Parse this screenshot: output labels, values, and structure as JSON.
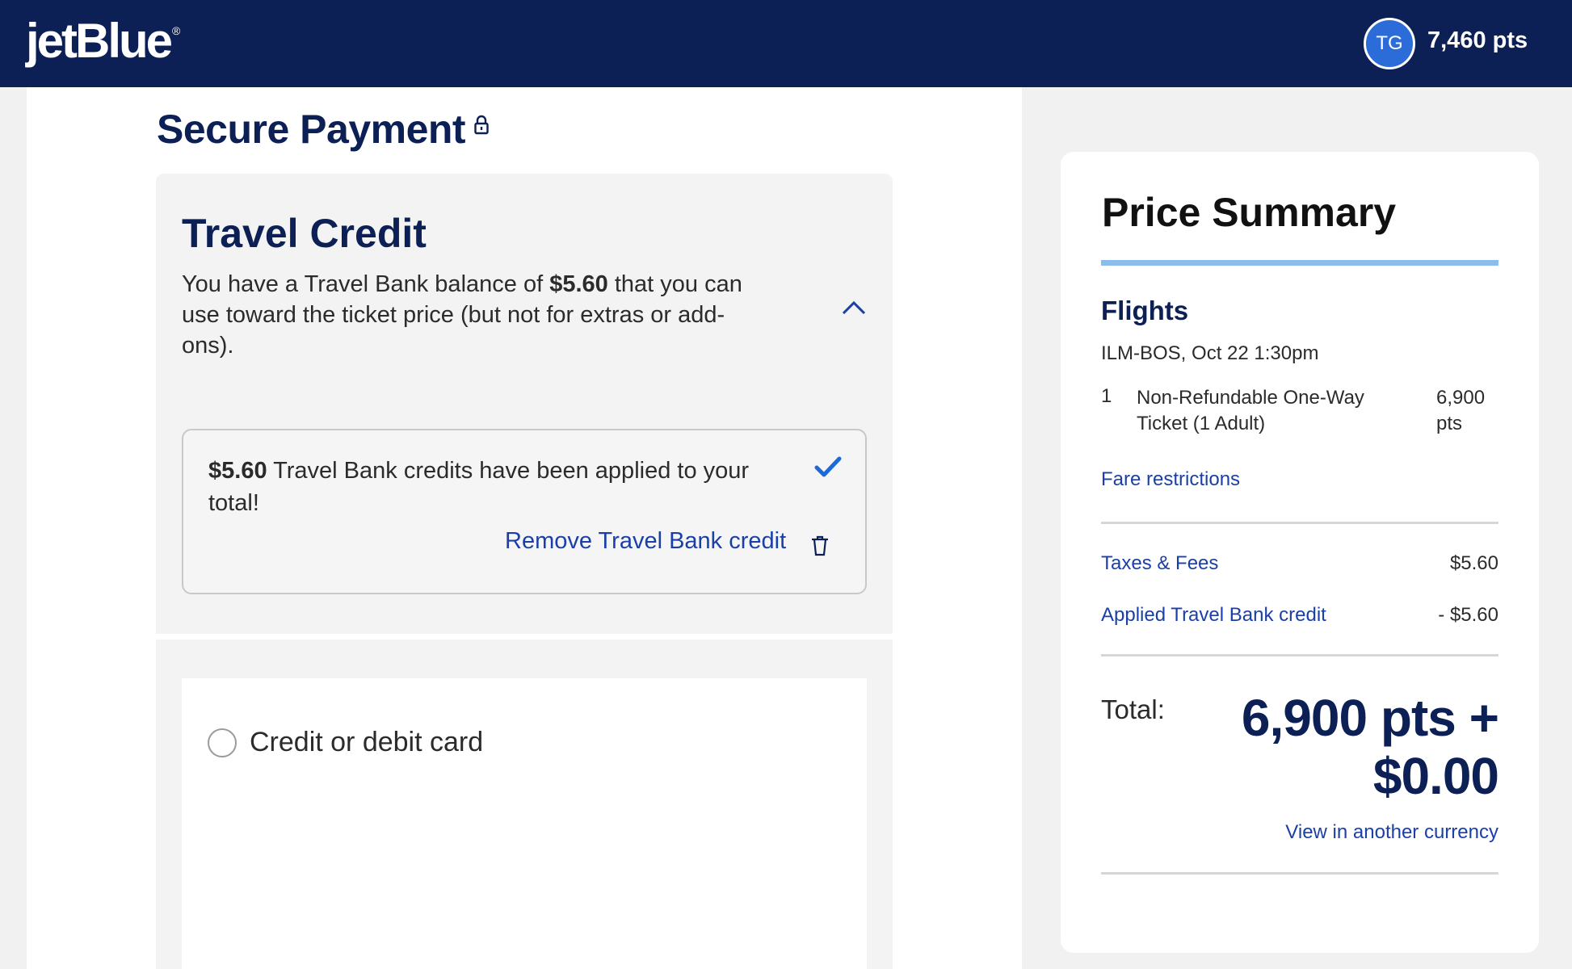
{
  "header": {
    "logo": "jetBlue",
    "logo_mark": "®",
    "user_initials": "TG",
    "points": "7,460 pts"
  },
  "page": {
    "title": "Secure Payment"
  },
  "travel_credit": {
    "title": "Travel Credit",
    "desc_before": "You have a Travel Bank balance of ",
    "balance": "$5.60",
    "desc_after": " that you can use toward the ticket price (but not for extras or add-ons).",
    "applied_amount": "$5.60",
    "applied_text": " Travel Bank credits have been applied to your total!",
    "remove_label": "Remove Travel Bank credit"
  },
  "payment": {
    "option_label": "Credit or debit card"
  },
  "summary": {
    "title": "Price Summary",
    "flights_heading": "Flights",
    "route": "ILM-BOS, Oct 22 1:30pm",
    "ticket_qty": "1",
    "ticket_desc": "Non-Refundable One-Way Ticket (1 Adult)",
    "ticket_price": "6,900 pts",
    "fare_link": "Fare restrictions",
    "taxes_label": "Taxes & Fees",
    "taxes_value": "$5.60",
    "credit_label": "Applied Travel Bank credit",
    "credit_value": "- $5.60",
    "total_label": "Total:",
    "total_points": "6,900 pts +",
    "total_cash": "$0.00",
    "currency_link": "View in another currency"
  },
  "colors": {
    "brand_navy": "#0c2056",
    "link_blue": "#1b3fa8",
    "accent_light_blue": "#8cbcea"
  }
}
